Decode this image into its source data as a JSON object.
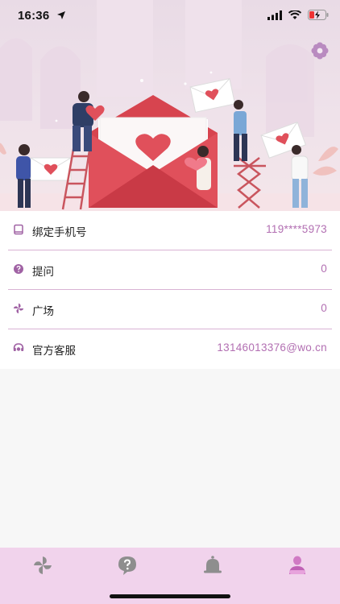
{
  "status_bar": {
    "time": "16:36"
  },
  "colors": {
    "accent": "#b26fb2",
    "divider": "#d9b2d4",
    "tabbar_bg": "#f1d3ec",
    "envelope_red": "#e0505b",
    "icon_purple": "#a062a4"
  },
  "header": {
    "settings_icon": "flower-gear-icon"
  },
  "settings_rows": [
    {
      "icon": "phone-book-icon",
      "label": "绑定手机号",
      "value": "119****5973"
    },
    {
      "icon": "question-circle-icon",
      "label": "提问",
      "value": "0"
    },
    {
      "icon": "pinwheel-icon",
      "label": "广场",
      "value": "0"
    },
    {
      "icon": "customer-service-icon",
      "label": "官方客服",
      "value": "13146013376@wo.cn"
    }
  ],
  "tabbar": {
    "tabs": [
      {
        "icon": "pinwheel-icon"
      },
      {
        "icon": "question-bubble-icon"
      },
      {
        "icon": "bell-icon"
      },
      {
        "icon": "user-icon",
        "active": true
      }
    ]
  }
}
